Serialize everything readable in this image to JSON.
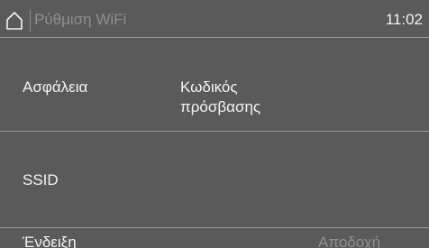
{
  "header": {
    "home_icon": "home-icon",
    "title": "Ρύθμιση WiFi",
    "time": "11:02"
  },
  "settings": {
    "security": {
      "label": "Ασφάλεια",
      "value": "Κωδικός πρόσβασης"
    },
    "ssid": {
      "label": "SSID",
      "value": ""
    }
  },
  "footer": {
    "show_label": "Ένδειξη",
    "accept_label": "Αποδοχή",
    "accept_enabled": false
  },
  "colors": {
    "background": "#5a5a5a",
    "text": "#f4f4f4",
    "disabled_text": "#8f8f8f",
    "divider": "#9a9a9a"
  }
}
